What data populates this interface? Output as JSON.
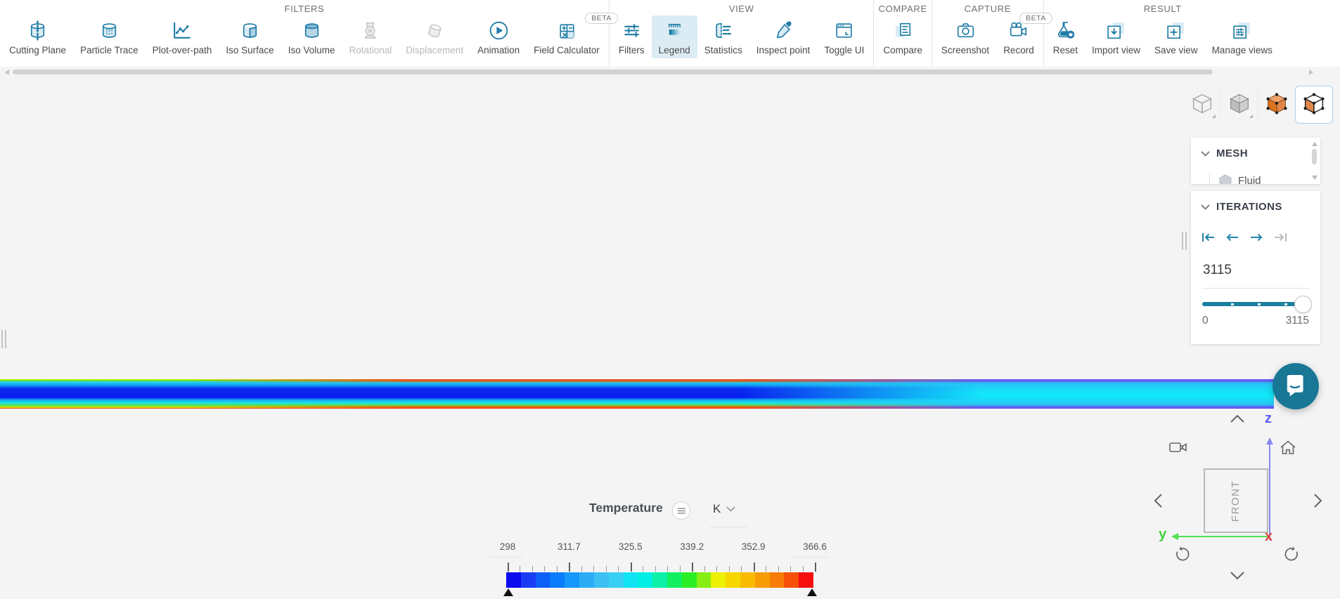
{
  "toolbar": {
    "beta_label": "BETA",
    "groups": [
      {
        "header": "FILTERS",
        "items": [
          {
            "label": "Cutting Plane",
            "icon": "cutting-plane"
          },
          {
            "label": "Particle Trace",
            "icon": "particle-trace"
          },
          {
            "label": "Plot-over-path",
            "icon": "plot-over-path"
          },
          {
            "label": "Iso Surface",
            "icon": "iso-surface"
          },
          {
            "label": "Iso Volume",
            "icon": "iso-volume"
          },
          {
            "label": "Rotational",
            "icon": "rotational",
            "disabled": true
          },
          {
            "label": "Displacement",
            "icon": "displacement",
            "disabled": true
          },
          {
            "label": "Animation",
            "icon": "animation"
          },
          {
            "label": "Field Calculator",
            "icon": "field-calculator",
            "beta": true
          }
        ]
      },
      {
        "header": "VIEW",
        "items": [
          {
            "label": "Filters",
            "icon": "filters"
          },
          {
            "label": "Legend",
            "icon": "legend",
            "active": true
          },
          {
            "label": "Statistics",
            "icon": "statistics"
          },
          {
            "label": "Inspect point",
            "icon": "inspect-point"
          },
          {
            "label": "Toggle UI",
            "icon": "toggle-ui"
          }
        ]
      },
      {
        "header": "COMPARE",
        "items": [
          {
            "label": "Compare",
            "icon": "compare"
          }
        ]
      },
      {
        "header": "CAPTURE",
        "items": [
          {
            "label": "Screenshot",
            "icon": "screenshot"
          },
          {
            "label": "Record",
            "icon": "record",
            "beta": true
          }
        ]
      },
      {
        "header": "RESULT",
        "items": [
          {
            "label": "Reset",
            "icon": "reset"
          },
          {
            "label": "Import view",
            "icon": "import-view"
          },
          {
            "label": "Save view",
            "icon": "save-view"
          },
          {
            "label": "Manage views",
            "icon": "manage-views"
          }
        ]
      }
    ]
  },
  "viewport": {
    "view_mode_buttons": [
      {
        "name": "outline-cube",
        "corner_mark": true
      },
      {
        "name": "solid-cube",
        "corner_mark": true
      },
      {
        "name": "mesh-surface-cube"
      },
      {
        "name": "mesh-wireframe-cube",
        "active": true
      }
    ]
  },
  "panels": {
    "mesh": {
      "title": "MESH",
      "truncated_item": "Fluid"
    },
    "iterations": {
      "title": "ITERATIONS",
      "value": "3115",
      "slider_min": "0",
      "slider_max": "3115",
      "slider_tick_fractions": [
        0.27,
        0.52,
        0.77
      ]
    }
  },
  "legend": {
    "title": "Temperature",
    "unit": "K",
    "tick_labels": [
      "298",
      "311.7",
      "325.5",
      "339.2",
      "352.9",
      "366.6"
    ],
    "minor_ticks_per_interval": 4,
    "colors": [
      "#0b0bf0",
      "#1a3df4",
      "#0d5ff8",
      "#0a7cfb",
      "#1598f9",
      "#2bacf5",
      "#3cc0f2",
      "#39cff2",
      "#0fe4f2",
      "#00eee4",
      "#0cf0a8",
      "#12ef63",
      "#2bee24",
      "#85ee12",
      "#eef005",
      "#f6d800",
      "#f8bb02",
      "#f89c04",
      "#f87c08",
      "#f6500a",
      "#f50f0f"
    ]
  },
  "nav_cube": {
    "front_label": "FRONT",
    "axis_x": "x",
    "axis_y": "y",
    "axis_z": "z"
  },
  "colors": {
    "accent": "#1e7ba6",
    "accent_light_fill": "#d9ebf4",
    "legend_active_bg": "#dcecf4",
    "slider_fill": "#1b7f9f",
    "chat_bubble": "#187795",
    "disabled_icon": "#c8c8c8"
  }
}
